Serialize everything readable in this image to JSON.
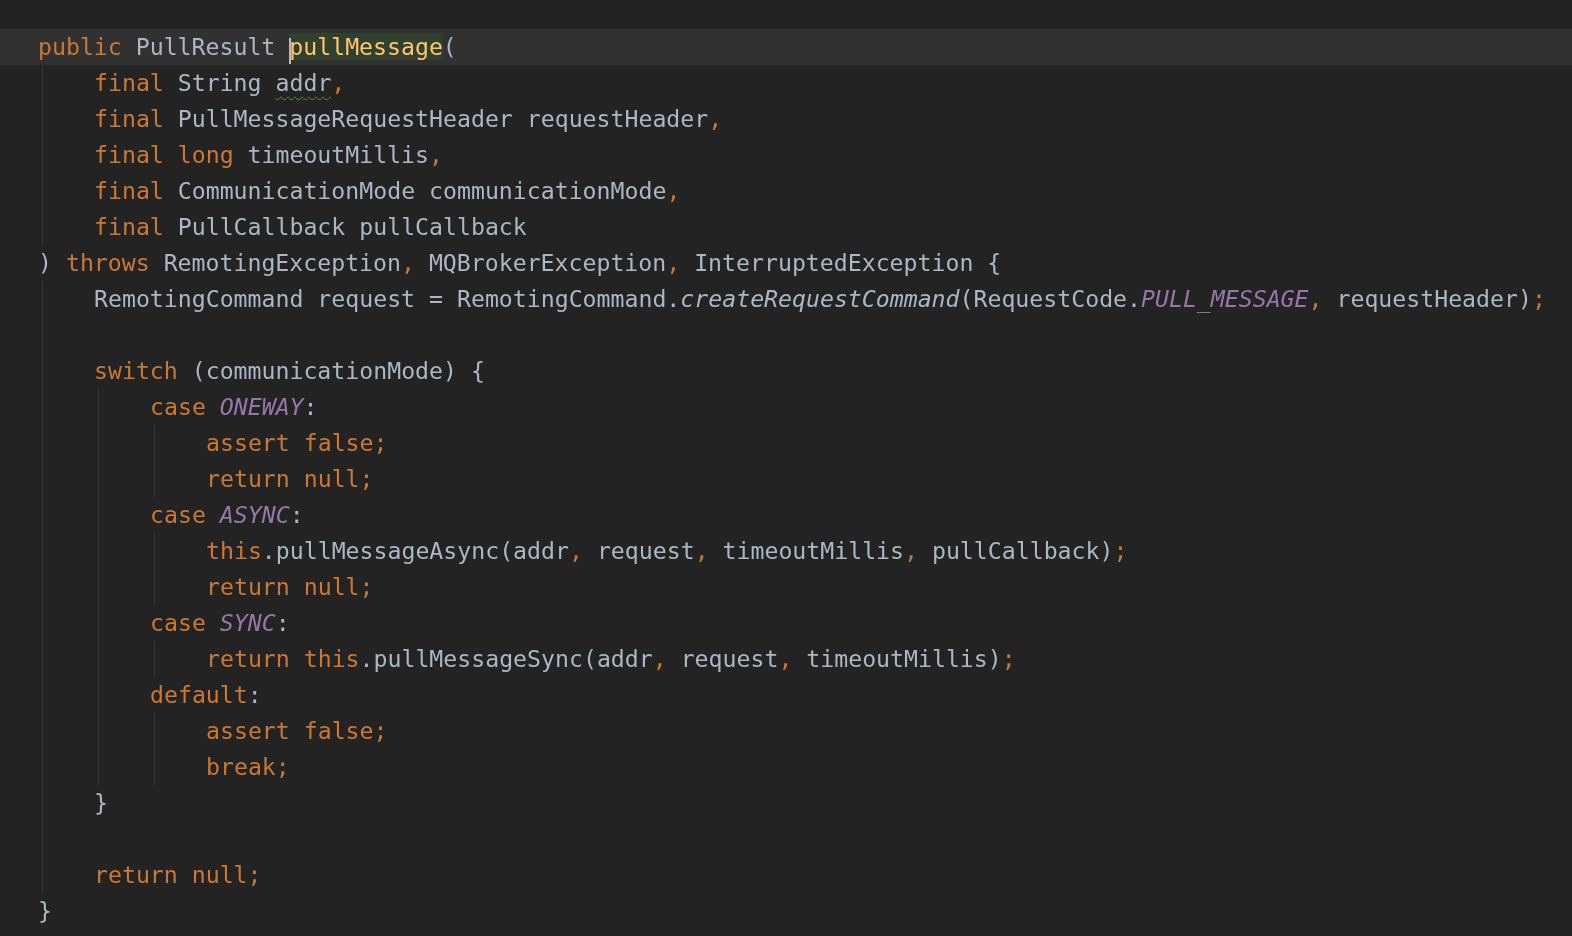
{
  "editor": {
    "lines": [
      {
        "kind": "code",
        "current": true,
        "tokens": [
          {
            "text": "public ",
            "kind": "keyword"
          },
          {
            "text": "PullResult ",
            "kind": "plain"
          },
          {
            "text": "pullMessage",
            "kind": "declaration",
            "highlighted": true
          },
          {
            "text": "(",
            "kind": "plain"
          }
        ],
        "children": [
          {
            "kind": "code",
            "current": false,
            "tokens": [
              {
                "text": "final ",
                "kind": "keyword"
              },
              {
                "text": "String ",
                "kind": "plain"
              },
              {
                "text": "addr",
                "kind": "plain",
                "warning": true
              },
              {
                "text": ",",
                "kind": "punct"
              }
            ]
          },
          {
            "kind": "code",
            "current": false,
            "tokens": [
              {
                "text": "final ",
                "kind": "keyword"
              },
              {
                "text": "PullMessageRequestHeader requestHeader",
                "kind": "plain"
              },
              {
                "text": ",",
                "kind": "punct"
              }
            ]
          },
          {
            "kind": "code",
            "current": false,
            "tokens": [
              {
                "text": "final long ",
                "kind": "keyword"
              },
              {
                "text": "timeoutMillis",
                "kind": "plain"
              },
              {
                "text": ",",
                "kind": "punct"
              }
            ]
          },
          {
            "kind": "code",
            "current": false,
            "tokens": [
              {
                "text": "final ",
                "kind": "keyword"
              },
              {
                "text": "CommunicationMode communicationMode",
                "kind": "plain"
              },
              {
                "text": ",",
                "kind": "punct"
              }
            ]
          },
          {
            "kind": "code",
            "current": false,
            "tokens": [
              {
                "text": "final ",
                "kind": "keyword"
              },
              {
                "text": "PullCallback pullCallback",
                "kind": "plain"
              }
            ]
          }
        ]
      },
      {
        "kind": "code",
        "current": false,
        "tokens": [
          {
            "text": ") ",
            "kind": "plain"
          },
          {
            "text": "throws ",
            "kind": "keyword"
          },
          {
            "text": "RemotingException",
            "kind": "plain"
          },
          {
            "text": ", ",
            "kind": "punct"
          },
          {
            "text": "MQBrokerException",
            "kind": "plain"
          },
          {
            "text": ", ",
            "kind": "punct"
          },
          {
            "text": "InterruptedException {",
            "kind": "plain"
          }
        ],
        "children": [
          {
            "kind": "code",
            "current": false,
            "tokens": [
              {
                "text": "RemotingCommand request = RemotingCommand.",
                "kind": "plain"
              },
              {
                "text": "createRequestCommand",
                "kind": "static-call"
              },
              {
                "text": "(RequestCode.",
                "kind": "plain"
              },
              {
                "text": "PULL_MESSAGE",
                "kind": "constant"
              },
              {
                "text": ", ",
                "kind": "punct"
              },
              {
                "text": "requestHeader)",
                "kind": "plain"
              },
              {
                "text": ";",
                "kind": "punct"
              }
            ]
          },
          {
            "kind": "blank"
          },
          {
            "kind": "code",
            "current": false,
            "tokens": [
              {
                "text": "switch ",
                "kind": "keyword"
              },
              {
                "text": "(communicationMode) {",
                "kind": "plain"
              }
            ],
            "children": [
              {
                "kind": "code",
                "current": false,
                "tokens": [
                  {
                    "text": "case ",
                    "kind": "keyword"
                  },
                  {
                    "text": "ONEWAY",
                    "kind": "constant"
                  },
                  {
                    "text": ":",
                    "kind": "plain"
                  }
                ],
                "children": [
                  {
                    "kind": "code",
                    "current": false,
                    "tokens": [
                      {
                        "text": "assert false;",
                        "kind": "keyword"
                      }
                    ]
                  },
                  {
                    "kind": "code",
                    "current": false,
                    "tokens": [
                      {
                        "text": "return null;",
                        "kind": "keyword"
                      }
                    ]
                  }
                ]
              },
              {
                "kind": "code",
                "current": false,
                "tokens": [
                  {
                    "text": "case ",
                    "kind": "keyword"
                  },
                  {
                    "text": "ASYNC",
                    "kind": "constant"
                  },
                  {
                    "text": ":",
                    "kind": "plain"
                  }
                ],
                "children": [
                  {
                    "kind": "code",
                    "current": false,
                    "tokens": [
                      {
                        "text": "this",
                        "kind": "keyword"
                      },
                      {
                        "text": ".pullMessageAsync(addr",
                        "kind": "plain"
                      },
                      {
                        "text": ", ",
                        "kind": "punct"
                      },
                      {
                        "text": "request",
                        "kind": "plain"
                      },
                      {
                        "text": ", ",
                        "kind": "punct"
                      },
                      {
                        "text": "timeoutMillis",
                        "kind": "plain"
                      },
                      {
                        "text": ", ",
                        "kind": "punct"
                      },
                      {
                        "text": "pullCallback)",
                        "kind": "plain"
                      },
                      {
                        "text": ";",
                        "kind": "punct"
                      }
                    ]
                  },
                  {
                    "kind": "code",
                    "current": false,
                    "tokens": [
                      {
                        "text": "return null;",
                        "kind": "keyword"
                      }
                    ]
                  }
                ]
              },
              {
                "kind": "code",
                "current": false,
                "tokens": [
                  {
                    "text": "case ",
                    "kind": "keyword"
                  },
                  {
                    "text": "SYNC",
                    "kind": "constant"
                  },
                  {
                    "text": ":",
                    "kind": "plain"
                  }
                ],
                "children": [
                  {
                    "kind": "code",
                    "current": false,
                    "tokens": [
                      {
                        "text": "return this",
                        "kind": "keyword"
                      },
                      {
                        "text": ".pullMessageSync(addr",
                        "kind": "plain"
                      },
                      {
                        "text": ", ",
                        "kind": "punct"
                      },
                      {
                        "text": "request",
                        "kind": "plain"
                      },
                      {
                        "text": ", ",
                        "kind": "punct"
                      },
                      {
                        "text": "timeoutMillis)",
                        "kind": "plain"
                      },
                      {
                        "text": ";",
                        "kind": "punct"
                      }
                    ]
                  }
                ]
              },
              {
                "kind": "code",
                "current": false,
                "tokens": [
                  {
                    "text": "default",
                    "kind": "keyword"
                  },
                  {
                    "text": ":",
                    "kind": "plain"
                  }
                ],
                "children": [
                  {
                    "kind": "code",
                    "current": false,
                    "tokens": [
                      {
                        "text": "assert false;",
                        "kind": "keyword"
                      }
                    ]
                  },
                  {
                    "kind": "code",
                    "current": false,
                    "tokens": [
                      {
                        "text": "break;",
                        "kind": "keyword"
                      }
                    ]
                  }
                ]
              }
            ]
          },
          {
            "kind": "code",
            "current": false,
            "tokens": [
              {
                "text": "}",
                "kind": "plain"
              }
            ]
          },
          {
            "kind": "blank"
          },
          {
            "kind": "code",
            "current": false,
            "tokens": [
              {
                "text": "return null;",
                "kind": "keyword"
              }
            ]
          }
        ]
      },
      {
        "kind": "code",
        "current": false,
        "tokens": [
          {
            "text": "}",
            "kind": "plain"
          }
        ]
      }
    ]
  }
}
